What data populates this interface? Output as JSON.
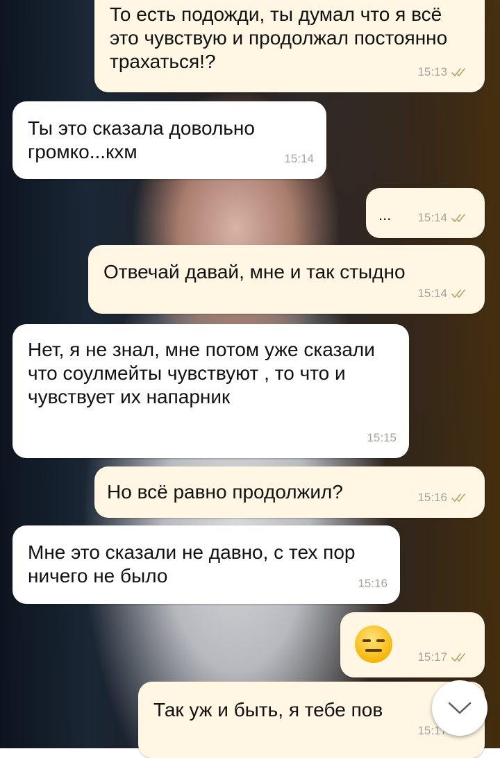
{
  "messages": [
    {
      "id": 1,
      "direction": "out",
      "text": "То есть подожди, ты думал что я всё это чувствую и продолжал постоянно трахаться!?",
      "time": "15:13",
      "read": true
    },
    {
      "id": 2,
      "direction": "in",
      "text": "Ты это сказала довольно громко...кхм",
      "time": "15:14"
    },
    {
      "id": 3,
      "direction": "out",
      "text": "...",
      "time": "15:14",
      "read": true
    },
    {
      "id": 4,
      "direction": "out",
      "text": "Отвечай давай, мне и так стыдно",
      "time": "15:14",
      "read": true
    },
    {
      "id": 5,
      "direction": "in",
      "text": "Нет, я не знал, мне потом уже сказали что соулмейты чувствуют , то что и чувствует их напарник",
      "time": "15:15"
    },
    {
      "id": 6,
      "direction": "out",
      "text": "Но всё равно продолжил?",
      "time": "15:16",
      "read": true
    },
    {
      "id": 7,
      "direction": "in",
      "text": "Мне это сказали не давно, с тех пор ничего не было",
      "time": "15:16"
    },
    {
      "id": 8,
      "direction": "out",
      "emoji": "expressionless-face",
      "time": "15:17",
      "read": true
    },
    {
      "id": 9,
      "direction": "out",
      "text": "Так уж и быть, я тебе пов",
      "time": "15:17",
      "read": true
    }
  ],
  "colors": {
    "outgoing_bubble": "#fff6e4",
    "incoming_bubble": "#ffffff",
    "timestamp": "#a4a39c",
    "read_check": "#b8a26a"
  },
  "icons": {
    "read_receipt": "double-check-icon",
    "scroll_down": "chevron-down-icon"
  }
}
